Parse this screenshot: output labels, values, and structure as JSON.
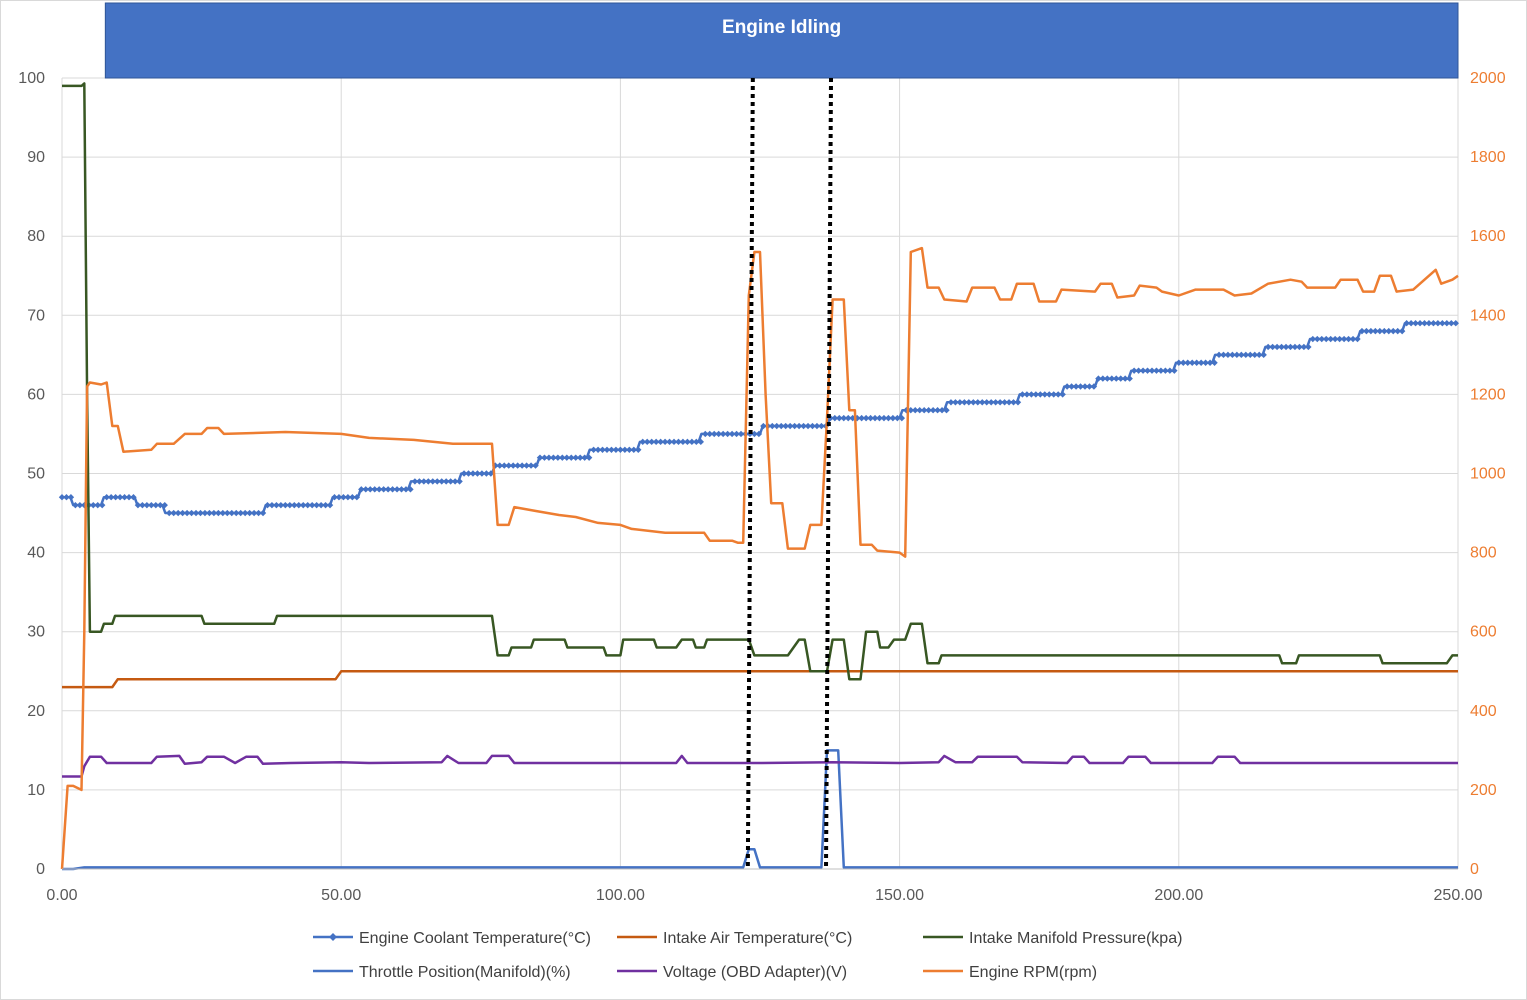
{
  "chart_data": {
    "type": "line",
    "x_range": [
      0,
      250
    ],
    "y_left_range": [
      0,
      100
    ],
    "y_right_range": [
      0,
      2000
    ],
    "x_ticks": [
      "0.00",
      "50.00",
      "100.00",
      "150.00",
      "200.00",
      "250.00"
    ],
    "y_left_ticks": [
      "0",
      "10",
      "20",
      "30",
      "40",
      "50",
      "60",
      "70",
      "80",
      "90",
      "100"
    ],
    "y_right_ticks": [
      "0",
      "200",
      "400",
      "600",
      "800",
      "1000",
      "1200",
      "1400",
      "1600",
      "1800",
      "2000"
    ],
    "grid": true,
    "legend_position": "bottom",
    "annotations": {
      "banner": {
        "label": "Engine Idling",
        "x_start": 4,
        "x_end": 250
      },
      "vertical_markers": [
        123,
        137
      ]
    },
    "series": [
      {
        "name": "Engine Coolant Temperature(°C)",
        "axis": "left",
        "color": "#4472C4",
        "marker": "diamond",
        "points": [
          [
            0,
            47
          ],
          [
            1.5,
            47
          ],
          [
            2,
            46
          ],
          [
            7,
            46
          ],
          [
            7.5,
            47
          ],
          [
            13,
            47
          ],
          [
            13.5,
            46
          ],
          [
            18,
            46
          ],
          [
            18.5,
            45
          ],
          [
            36,
            45
          ],
          [
            36.5,
            46
          ],
          [
            48,
            46
          ],
          [
            48.5,
            47
          ],
          [
            53,
            47
          ],
          [
            53.5,
            48
          ],
          [
            62,
            48
          ],
          [
            62.5,
            49
          ],
          [
            71,
            49
          ],
          [
            71.5,
            50
          ],
          [
            77,
            50
          ],
          [
            77.5,
            51
          ],
          [
            85,
            51
          ],
          [
            85.5,
            52
          ],
          [
            94,
            52
          ],
          [
            94.5,
            53
          ],
          [
            103,
            53
          ],
          [
            103.5,
            54
          ],
          [
            114,
            54
          ],
          [
            114.5,
            55
          ],
          [
            125,
            55
          ],
          [
            125.5,
            56
          ],
          [
            137,
            56
          ],
          [
            137.5,
            57
          ],
          [
            150,
            57
          ],
          [
            150.5,
            58
          ],
          [
            158,
            58
          ],
          [
            158.5,
            59
          ],
          [
            171,
            59
          ],
          [
            171.5,
            60
          ],
          [
            179,
            60
          ],
          [
            179.5,
            61
          ],
          [
            185,
            61
          ],
          [
            185.5,
            62
          ],
          [
            191,
            62
          ],
          [
            191.5,
            63
          ],
          [
            199,
            63
          ],
          [
            199.5,
            64
          ],
          [
            206,
            64
          ],
          [
            206.5,
            65
          ],
          [
            215,
            65
          ],
          [
            215.5,
            66
          ],
          [
            223,
            66
          ],
          [
            223.5,
            67
          ],
          [
            232,
            67
          ],
          [
            232.5,
            68
          ],
          [
            240,
            68
          ],
          [
            240.5,
            69
          ],
          [
            250,
            69
          ]
        ]
      },
      {
        "name": "Intake Air Temperature(°C)",
        "axis": "left",
        "color": "#C55A11",
        "marker": "none",
        "points": [
          [
            0,
            23
          ],
          [
            9,
            23
          ],
          [
            10,
            24
          ],
          [
            49,
            24
          ],
          [
            50,
            25
          ],
          [
            250,
            25
          ]
        ]
      },
      {
        "name": "Intake Manifold Pressure(kpa)",
        "axis": "left",
        "color": "#385723",
        "marker": "none",
        "points": [
          [
            0,
            99
          ],
          [
            3.5,
            99
          ],
          [
            4,
            99.3
          ],
          [
            4.5,
            60
          ],
          [
            5,
            30
          ],
          [
            7,
            30
          ],
          [
            7.5,
            31
          ],
          [
            9,
            31
          ],
          [
            9.5,
            32
          ],
          [
            25,
            32
          ],
          [
            25.5,
            31
          ],
          [
            38,
            31
          ],
          [
            38.5,
            32
          ],
          [
            77,
            32
          ],
          [
            78,
            27
          ],
          [
            80,
            27
          ],
          [
            80.5,
            28
          ],
          [
            84,
            28
          ],
          [
            84.5,
            29
          ],
          [
            90,
            29
          ],
          [
            90.5,
            28
          ],
          [
            97,
            28
          ],
          [
            97.5,
            27
          ],
          [
            100,
            27
          ],
          [
            100.5,
            29
          ],
          [
            106,
            29
          ],
          [
            106.5,
            28
          ],
          [
            110,
            28
          ],
          [
            111,
            29
          ],
          [
            113,
            29
          ],
          [
            113.5,
            28
          ],
          [
            115,
            28
          ],
          [
            115.5,
            29
          ],
          [
            123,
            29
          ],
          [
            124,
            27
          ],
          [
            130,
            27
          ],
          [
            131,
            28
          ],
          [
            132,
            29
          ],
          [
            133,
            29
          ],
          [
            134,
            25
          ],
          [
            137,
            25
          ],
          [
            138,
            29
          ],
          [
            140,
            29
          ],
          [
            141,
            24
          ],
          [
            143,
            24
          ],
          [
            144,
            30
          ],
          [
            146,
            30
          ],
          [
            146.5,
            28
          ],
          [
            148,
            28
          ],
          [
            149,
            29
          ],
          [
            151,
            29
          ],
          [
            152,
            31
          ],
          [
            154,
            31
          ],
          [
            155,
            26
          ],
          [
            157,
            26
          ],
          [
            157.5,
            27
          ],
          [
            218,
            27
          ],
          [
            218.5,
            26
          ],
          [
            221,
            26
          ],
          [
            221.5,
            27
          ],
          [
            236,
            27
          ],
          [
            236.5,
            26
          ],
          [
            248,
            26
          ],
          [
            249,
            27
          ],
          [
            250,
            27
          ]
        ]
      },
      {
        "name": "Throttle Position(Manifold)(%)",
        "axis": "left",
        "color": "#4472C4",
        "marker": "none",
        "points": [
          [
            0,
            0
          ],
          [
            2,
            0
          ],
          [
            4,
            0.2
          ],
          [
            122,
            0.2
          ],
          [
            123,
            2.5
          ],
          [
            124,
            2.5
          ],
          [
            125,
            0.2
          ],
          [
            136,
            0.2
          ],
          [
            137,
            15
          ],
          [
            139,
            15
          ],
          [
            140,
            0.2
          ],
          [
            250,
            0.2
          ]
        ]
      },
      {
        "name": "Voltage (OBD Adapter)(V)",
        "axis": "left",
        "color": "#7030A0",
        "marker": "none",
        "points": [
          [
            0,
            11.7
          ],
          [
            3.5,
            11.7
          ],
          [
            4,
            13
          ],
          [
            5,
            14.2
          ],
          [
            7,
            14.2
          ],
          [
            8,
            13.4
          ],
          [
            16,
            13.4
          ],
          [
            17,
            14.2
          ],
          [
            21,
            14.3
          ],
          [
            22,
            13.3
          ],
          [
            25,
            13.5
          ],
          [
            26,
            14.2
          ],
          [
            29,
            14.2
          ],
          [
            31,
            13.4
          ],
          [
            33,
            14.2
          ],
          [
            35,
            14.2
          ],
          [
            36,
            13.3
          ],
          [
            41,
            13.4
          ],
          [
            50,
            13.5
          ],
          [
            55,
            13.4
          ],
          [
            68,
            13.5
          ],
          [
            69,
            14.3
          ],
          [
            71,
            13.4
          ],
          [
            76,
            13.4
          ],
          [
            77,
            14.3
          ],
          [
            80,
            14.3
          ],
          [
            81,
            13.4
          ],
          [
            110,
            13.4
          ],
          [
            111,
            14.3
          ],
          [
            112,
            13.4
          ],
          [
            125,
            13.4
          ],
          [
            138,
            13.5
          ],
          [
            150,
            13.4
          ],
          [
            157,
            13.5
          ],
          [
            158,
            14.3
          ],
          [
            160,
            13.5
          ],
          [
            163,
            13.5
          ],
          [
            164,
            14.2
          ],
          [
            171,
            14.2
          ],
          [
            172,
            13.5
          ],
          [
            180,
            13.4
          ],
          [
            181,
            14.2
          ],
          [
            183,
            14.2
          ],
          [
            184,
            13.4
          ],
          [
            190,
            13.4
          ],
          [
            191,
            14.2
          ],
          [
            194,
            14.2
          ],
          [
            195,
            13.4
          ],
          [
            206,
            13.4
          ],
          [
            207,
            14.2
          ],
          [
            210,
            14.2
          ],
          [
            211,
            13.4
          ],
          [
            250,
            13.4
          ]
        ]
      },
      {
        "name": "Engine RPM(rpm)",
        "axis": "right",
        "color": "#ED7D31",
        "marker": "none",
        "points": [
          [
            0,
            0
          ],
          [
            1,
            210
          ],
          [
            2,
            210
          ],
          [
            3.5,
            200
          ],
          [
            4,
            600
          ],
          [
            4.5,
            1220
          ],
          [
            5,
            1230
          ],
          [
            7,
            1225
          ],
          [
            8,
            1230
          ],
          [
            9,
            1120
          ],
          [
            10,
            1120
          ],
          [
            11,
            1055
          ],
          [
            16,
            1060
          ],
          [
            17,
            1075
          ],
          [
            20,
            1075
          ],
          [
            22,
            1100
          ],
          [
            25,
            1100
          ],
          [
            26,
            1115
          ],
          [
            28,
            1115
          ],
          [
            29,
            1100
          ],
          [
            40,
            1105
          ],
          [
            50,
            1100
          ],
          [
            55,
            1090
          ],
          [
            63,
            1085
          ],
          [
            70,
            1075
          ],
          [
            77,
            1075
          ],
          [
            78,
            870
          ],
          [
            80,
            870
          ],
          [
            81,
            915
          ],
          [
            85,
            905
          ],
          [
            89,
            895
          ],
          [
            92,
            890
          ],
          [
            96,
            875
          ],
          [
            100,
            870
          ],
          [
            102,
            860
          ],
          [
            108,
            850
          ],
          [
            115,
            850
          ],
          [
            116,
            830
          ],
          [
            120,
            830
          ],
          [
            121,
            825
          ],
          [
            122,
            825
          ],
          [
            123,
            1450
          ],
          [
            124,
            1560
          ],
          [
            125,
            1560
          ],
          [
            126,
            1200
          ],
          [
            127,
            925
          ],
          [
            129,
            925
          ],
          [
            130,
            810
          ],
          [
            133,
            810
          ],
          [
            134,
            870
          ],
          [
            136,
            870
          ],
          [
            137,
            1140
          ],
          [
            138,
            1440
          ],
          [
            140,
            1440
          ],
          [
            141,
            1160
          ],
          [
            142,
            1160
          ],
          [
            143,
            820
          ],
          [
            145,
            820
          ],
          [
            146,
            805
          ],
          [
            150,
            800
          ],
          [
            151,
            790
          ],
          [
            152,
            1560
          ],
          [
            154,
            1570
          ],
          [
            155,
            1470
          ],
          [
            157,
            1470
          ],
          [
            158,
            1440
          ],
          [
            162,
            1435
          ],
          [
            163,
            1470
          ],
          [
            167,
            1470
          ],
          [
            168,
            1440
          ],
          [
            170,
            1440
          ],
          [
            171,
            1480
          ],
          [
            174,
            1480
          ],
          [
            175,
            1435
          ],
          [
            178,
            1435
          ],
          [
            179,
            1465
          ],
          [
            185,
            1460
          ],
          [
            186,
            1480
          ],
          [
            188,
            1480
          ],
          [
            189,
            1445
          ],
          [
            192,
            1450
          ],
          [
            193,
            1475
          ],
          [
            196,
            1470
          ],
          [
            197,
            1460
          ],
          [
            200,
            1450
          ],
          [
            203,
            1465
          ],
          [
            208,
            1465
          ],
          [
            210,
            1450
          ],
          [
            213,
            1455
          ],
          [
            216,
            1480
          ],
          [
            220,
            1490
          ],
          [
            222,
            1485
          ],
          [
            223,
            1470
          ],
          [
            228,
            1470
          ],
          [
            229,
            1490
          ],
          [
            232,
            1490
          ],
          [
            233,
            1460
          ],
          [
            235,
            1460
          ],
          [
            236,
            1500
          ],
          [
            238,
            1500
          ],
          [
            239,
            1460
          ],
          [
            242,
            1465
          ],
          [
            244,
            1490
          ],
          [
            246,
            1515
          ],
          [
            247,
            1480
          ],
          [
            249,
            1490
          ],
          [
            250,
            1500
          ]
        ]
      }
    ]
  }
}
